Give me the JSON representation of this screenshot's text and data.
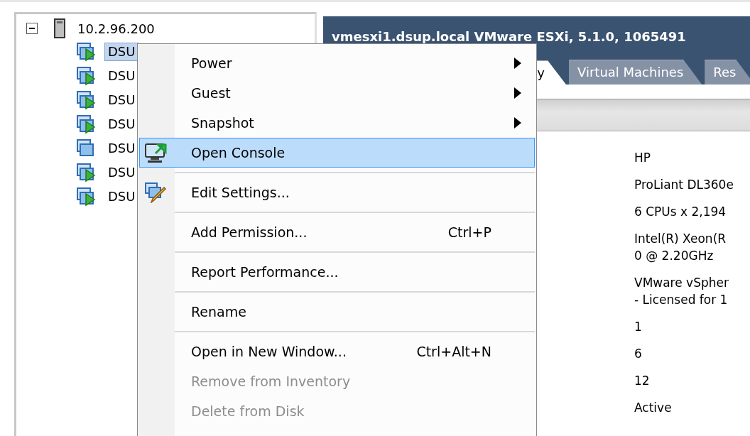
{
  "tree": {
    "root": {
      "label": "10.2.96.200",
      "expanded": true,
      "children": [
        {
          "label": "DSU",
          "selected": true,
          "powered_on": true
        },
        {
          "label": "DSU",
          "selected": false,
          "powered_on": true
        },
        {
          "label": "DSU",
          "selected": false,
          "powered_on": true
        },
        {
          "label": "DSU",
          "selected": false,
          "powered_on": true
        },
        {
          "label": "DSU",
          "selected": false,
          "powered_on": false
        },
        {
          "label": "DSU",
          "selected": false,
          "powered_on": true
        },
        {
          "label": "DSU",
          "selected": false,
          "powered_on": true
        }
      ]
    }
  },
  "host_panel": {
    "title": "vmesxi1.dsup.local VMware ESXi, 5.1.0, 1065491",
    "tabs": [
      {
        "label": "y",
        "selected": true
      },
      {
        "label": "Virtual Machines",
        "selected": false
      },
      {
        "label": "Res",
        "selected": false
      }
    ],
    "details": [
      {
        "lines": [
          "HP"
        ]
      },
      {
        "lines": [
          "ProLiant DL360e"
        ]
      },
      {
        "lines": [
          "6 CPUs x 2,194"
        ]
      },
      {
        "lines": [
          "Intel(R) Xeon(R",
          "0 @ 2.20GHz"
        ]
      },
      {
        "lines": [
          "VMware vSpher",
          "- Licensed for 1"
        ]
      },
      {
        "lines": [
          "1"
        ]
      },
      {
        "lines": [
          "6"
        ]
      },
      {
        "lines": [
          "12"
        ]
      },
      {
        "lines": [
          "Active"
        ]
      }
    ]
  },
  "context_menu": {
    "items": [
      {
        "label": "Power",
        "submenu": true,
        "selected": false,
        "disabled": false,
        "separator_after": false
      },
      {
        "label": "Guest",
        "submenu": true,
        "selected": false,
        "disabled": false,
        "separator_after": false
      },
      {
        "label": "Snapshot",
        "submenu": true,
        "selected": false,
        "disabled": false,
        "separator_after": false
      },
      {
        "label": "Open Console",
        "kind": "console",
        "submenu": false,
        "selected": true,
        "disabled": false,
        "separator_after": true
      },
      {
        "label": "Edit Settings...",
        "kind": "edit",
        "submenu": false,
        "selected": false,
        "disabled": false,
        "separator_after": true
      },
      {
        "label": "Add Permission...",
        "shortcut": "Ctrl+P",
        "submenu": false,
        "selected": false,
        "disabled": false,
        "separator_after": true
      },
      {
        "label": "Report Performance...",
        "submenu": false,
        "selected": false,
        "disabled": false,
        "separator_after": true
      },
      {
        "label": "Rename",
        "submenu": false,
        "selected": false,
        "disabled": false,
        "separator_after": true
      },
      {
        "label": "Open in New Window...",
        "shortcut": "Ctrl+Alt+N",
        "submenu": false,
        "selected": false,
        "disabled": false,
        "separator_after": false
      },
      {
        "label": "Remove from Inventory",
        "submenu": false,
        "selected": false,
        "disabled": true,
        "separator_after": false
      },
      {
        "label": "Delete from Disk",
        "submenu": false,
        "selected": false,
        "disabled": true,
        "separator_after": false
      }
    ]
  }
}
